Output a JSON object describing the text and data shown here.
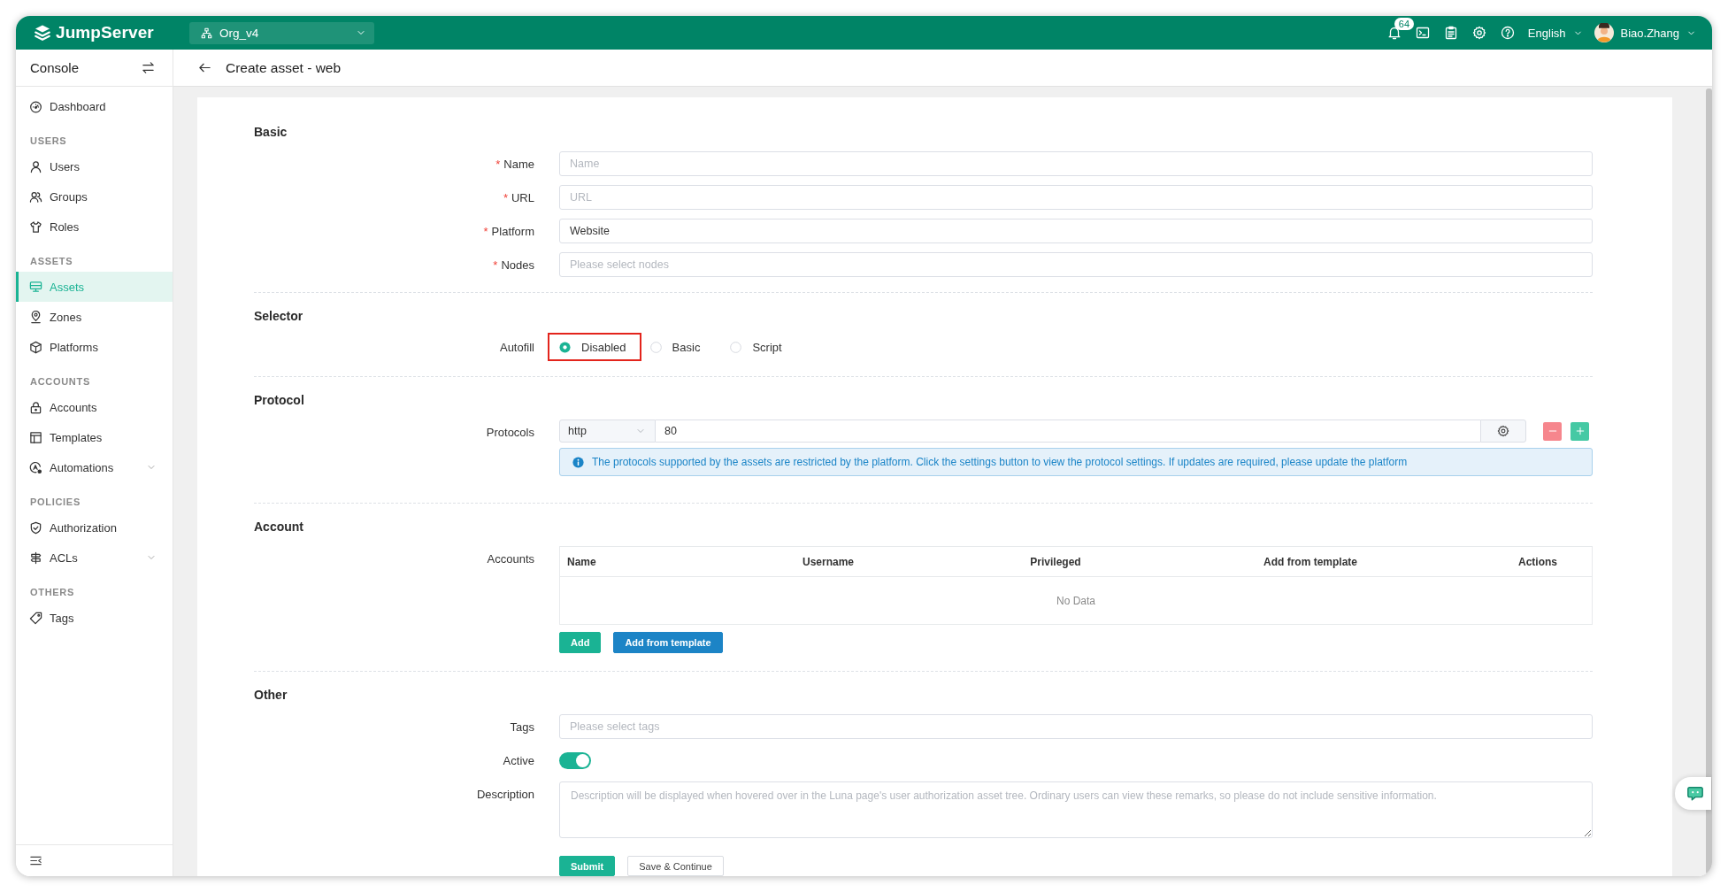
{
  "top_bar": {
    "logo": "JumpServer",
    "org": "Org_v4",
    "notification_count": "64",
    "language": "English",
    "user": "Biao.Zhang"
  },
  "sidebar": {
    "title": "Console",
    "groups": [
      {
        "items": [
          {
            "label": "Dashboard",
            "kind": "link",
            "selected": false
          }
        ]
      },
      {
        "heading": "USERS",
        "items": [
          {
            "label": "Users",
            "kind": "link",
            "selected": false
          },
          {
            "label": "Groups",
            "kind": "link",
            "selected": false
          },
          {
            "label": "Roles",
            "kind": "link",
            "selected": false
          }
        ]
      },
      {
        "heading": "ASSETS",
        "items": [
          {
            "label": "Assets",
            "kind": "link",
            "selected": true
          },
          {
            "label": "Zones",
            "kind": "link",
            "selected": false
          },
          {
            "label": "Platforms",
            "kind": "link",
            "selected": false
          }
        ]
      },
      {
        "heading": "ACCOUNTS",
        "items": [
          {
            "label": "Accounts",
            "kind": "link",
            "selected": false
          },
          {
            "label": "Templates",
            "kind": "link",
            "selected": false
          },
          {
            "label": "Automations",
            "kind": "submenu",
            "expanded": false,
            "selected": false
          }
        ]
      },
      {
        "heading": "POLICIES",
        "items": [
          {
            "label": "Authorization",
            "kind": "link",
            "selected": false
          },
          {
            "label": "ACLs",
            "kind": "submenu",
            "expanded": false,
            "selected": false
          }
        ]
      },
      {
        "heading": "OTHERS",
        "items": [
          {
            "label": "Tags",
            "kind": "link",
            "selected": false
          }
        ]
      }
    ]
  },
  "page": {
    "title": "Create asset - web"
  },
  "form": {
    "sections": [
      {
        "title": "Basic",
        "fields": [
          {
            "kind": "text",
            "required_mark": "*",
            "label": "Name",
            "placeholder": "Name"
          },
          {
            "kind": "text",
            "required_mark": "*",
            "label": "URL",
            "placeholder": "URL"
          },
          {
            "kind": "text",
            "required_mark": "*",
            "label": "Platform",
            "value": "Website"
          },
          {
            "kind": "text",
            "required_mark": "*",
            "label": "Nodes",
            "placeholder": "Please select nodes"
          }
        ]
      },
      {
        "title": "Selector",
        "fields": [
          {
            "kind": "radio",
            "label": "Autofill",
            "options": [
              {
                "label": "Disabled",
                "selected": true,
                "highlighted": true
              },
              {
                "label": "Basic",
                "selected": false,
                "highlighted": false
              },
              {
                "label": "Script",
                "selected": false,
                "highlighted": false
              }
            ]
          }
        ]
      },
      {
        "title": "Protocol",
        "fields": [
          {
            "kind": "protocols",
            "label": "Protocols",
            "rows": [
              {
                "protocol": "http",
                "port": "80"
              }
            ],
            "notice": "The protocols supported by the assets are restricted by the platform. Click the settings button to view the protocol settings. If updates are required, please update the platform"
          }
        ]
      },
      {
        "title": "Account",
        "fields": [
          {
            "kind": "table",
            "label": "Accounts",
            "columns": [
              "Name",
              "Username",
              "Privileged",
              "Add from template",
              "Actions"
            ],
            "empty_text": "No Data",
            "buttons": [
              {
                "label": "Add",
                "kind": "primary"
              },
              {
                "label": "Add from template",
                "kind": "info"
              }
            ]
          }
        ]
      },
      {
        "title": "Other",
        "fields": [
          {
            "kind": "text",
            "label": "Tags",
            "placeholder": "Please select tags"
          },
          {
            "kind": "switch",
            "label": "Active",
            "on": true
          },
          {
            "kind": "textarea",
            "label": "Description",
            "placeholder": "Description will be displayed when hovered over in the Luna page's user authorization asset tree. Ordinary users can view these remarks, so please do not include sensitive information."
          }
        ]
      }
    ],
    "actions": [
      {
        "label": "Submit",
        "kind": "primary"
      },
      {
        "label": "Save & Continue",
        "kind": "default"
      }
    ]
  }
}
